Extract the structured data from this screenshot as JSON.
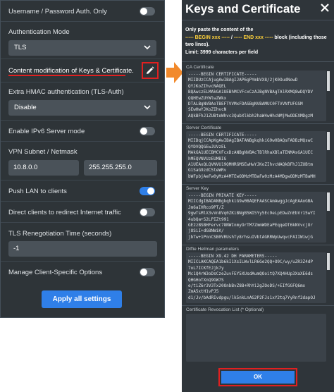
{
  "left_panel": {
    "username_password": {
      "label": "Username / Password Auth. Only",
      "toggle_on": false
    },
    "auth_mode": {
      "label": "Authentication Mode",
      "value": "TLS"
    },
    "keys_cert": {
      "label": "Content modification of Keys & Certificate."
    },
    "hmac": {
      "label": "Extra HMAC authentication (TLS-Auth)",
      "value": "Disable"
    },
    "ipv6": {
      "label": "Enable IPv6 Server mode",
      "toggle_on": false
    },
    "subnet": {
      "label": "VPN Subnet / Netmask",
      "subnet_value": "10.8.0.0",
      "netmask_value": "255.255.255.0"
    },
    "push_lan": {
      "label": "Push LAN to clients",
      "toggle_on": true
    },
    "redirect": {
      "label": "Direct clients to redirect Internet traffic",
      "toggle_on": false
    },
    "renegotiation": {
      "label": "TLS Renegotiation Time (seconds)",
      "value": "-1"
    },
    "client_specific": {
      "label": "Manage Client-Specific Options",
      "toggle_on": false
    },
    "apply_label": "Apply all settings"
  },
  "right_panel": {
    "title": "Keys and Certificate",
    "info_1": "Only paste the content of the",
    "info_2a": "----- BEGIN xxx -----",
    "info_2b": " / ",
    "info_2c": "----- END xxx -----",
    "info_2d": " block (including those two lines).",
    "info_3": "Limit: 3999 characters per field",
    "ca": {
      "label": "CA Certificate",
      "lines": [
        "-----BEGIN CERTIFICATE-----",
        "MIIDUzCCAjugAwIBAgIJAP6gPYmbVX8/2jK0OudNowD",
        "QYJKoZIhvcNAQEL",
        "BQAwczELMAkGA1UEBhMCVFcxCzAJBgNVBAgTAlRXMQ8wDQYDV",
        "QQHEwZUYWlwZWkx",
        "DTALBgNVBAoTBEFTVVMxFDASBgNVBAMUC0FTVVNfUFGSM",
        "SEwHwYJKoZIhvcN",
        "AQkBFhJ1ZUBteWhvc3QubXlkbh2haW4wHhcNMjMwODEXMDgzM"
      ]
    },
    "server_cert": {
      "label": "Server Certificate",
      "lines": [
        "-----BEGIN CERTIFICATE-----",
        "MIIDqjCCApKgAwIBAgIBATANBgkqhkiG9w0BAQsFADBzMQswC",
        "QYDVQQGEwJUVzEL",
        "MAkGA1UECBMCVFcxDzANBgNVBAcTBlRhaXBlaTENMAsGA1UEC",
        "hMEQVNVUzEUMBIG",
        "A1UEAxQLQVNVU19QMHRGMSEwHwYJKoZIhvcNAQkBFhJ1ZUBtm",
        "G1SaG9zdC5teWRv",
        "bWFpbjAeFw0yMzA4MTEwODMzMTBaFw0zMzA4MDgwODMzMTBaMH"
      ]
    },
    "server_key": {
      "label": "Server Key",
      "lines": [
        "-----BEGIN PRIVATE KEY-----",
        "MIICdgIBADANBgkqhkiG9w0BAQEFAASCAmAwggJcAgEAAoGBA",
        "Jm6aIHRco9PT/Z",
        "9gwTsMlX3vVn8Vq0ZKiBNgB5WI5Yy5Ec9eLpEDwZnEbVr15wYI",
        "4ubQa+S2LPIZt991",
        "GE2zBSBHFervc78NWInmyOrTM7ZmmWDEaPEqqeDT6kNVvcjUr",
        "jOSiI+dG8NWiK/",
        "jbTw+1PnnCSB0VRUshTy8rhsuIVbtAGRRWpUwqvcFAIIWiwjG"
      ]
    },
    "dh": {
      "label": "Diffie Hellman parameters",
      "lines": [
        "-----BEGIN X9.42 DH PARAMETERS-----",
        "MIICLAKCAQEA1b6kI1XsILWvlLR6Ge2QQ+O9C/wy/uZR3Z4dP",
        "7oL7ICKfEJjk7y",
        "Mc1Q4rW3oDsCzeZuvFEY5XUsdAumQOoitQ7XQ4HUp3XaXE6ds",
        "QHGHoTXnQ9GW7S",
        "e/tiZ6r3V3Tx20OnbBvZ8B+RhYi2gZOoDS/+EIfGGFQ6mx",
        "ZmA5xtH1vPJ5",
        "d1/Jv/bAdRIvdpgu/lk5nkLnAG2P2FJs1xY2tq7YyRnf2dapOJ"
      ]
    },
    "crl": {
      "label": "Certificate Revocation List (* Optional)"
    },
    "ok_label": "OK"
  }
}
